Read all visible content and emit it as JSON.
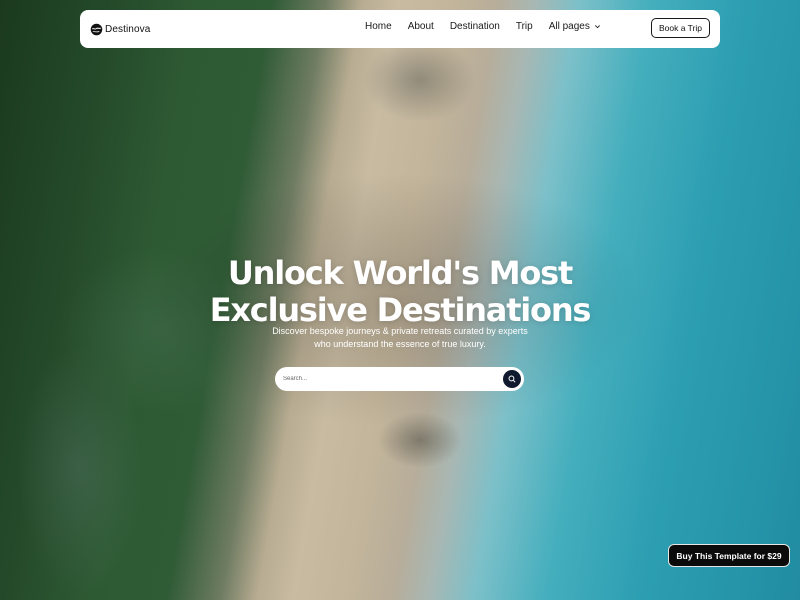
{
  "brand": {
    "name": "Destinova",
    "logo_icon": "globe-icon"
  },
  "nav": {
    "links": [
      "Home",
      "About",
      "Destination",
      "Trip"
    ],
    "dropdown_label": "All pages",
    "dropdown_icon": "chevron-down-icon",
    "cta_label": "Book a Trip"
  },
  "hero": {
    "title_line1": "Unlock World's Most",
    "title_line2": "Exclusive Destinations",
    "subtitle_line1": "Discover bespoke journeys & private retreats curated by experts",
    "subtitle_line2": "who understand the essence of true luxury."
  },
  "search": {
    "placeholder": "Search...",
    "value": "",
    "button_icon": "search-icon"
  },
  "buy_badge": {
    "label": "Buy This Template for $29"
  },
  "colors": {
    "navbar_bg": "#ffffff",
    "search_button_bg": "#0f1a2e",
    "badge_bg": "#0b0b0b",
    "hero_text": "#ffffff"
  }
}
